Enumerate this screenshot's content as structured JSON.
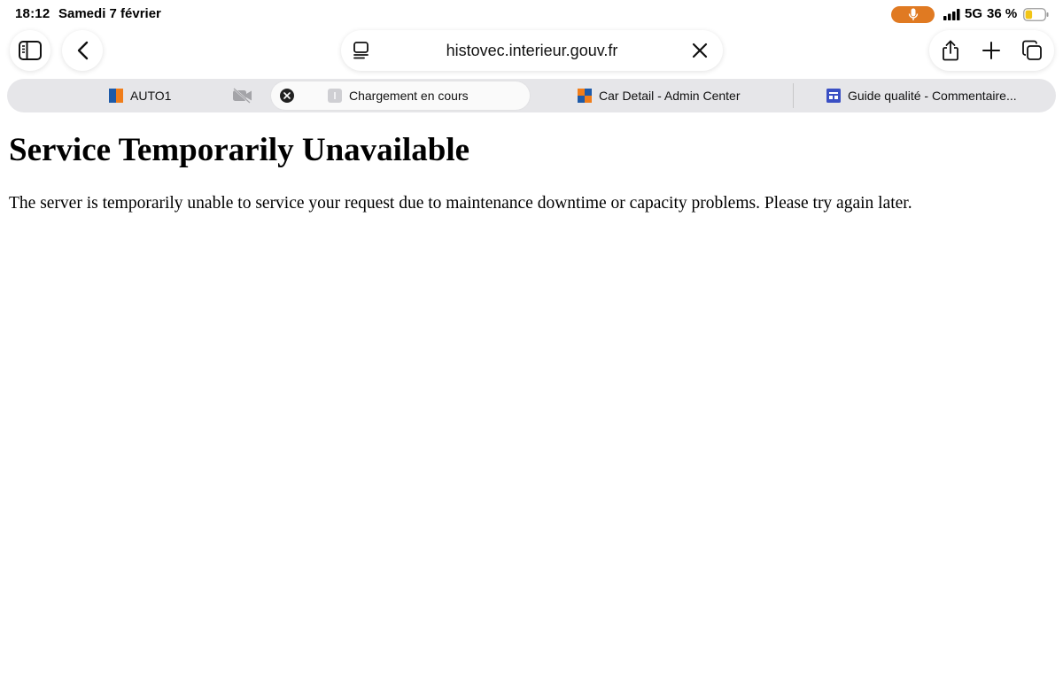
{
  "status_bar": {
    "time": "18:12",
    "date": "Samedi 7 février",
    "network": "5G",
    "battery_percent": "36 %",
    "battery_level": 0.36,
    "mic_color": "#e07a22"
  },
  "toolbar": {
    "url": "histovec.interieur.gouv.fr",
    "icons": [
      "sidebar-icon",
      "back-icon",
      "reader-icon",
      "stop-loading-icon",
      "share-icon",
      "new-tab-icon",
      "tabs-overview-icon"
    ]
  },
  "tabs": [
    {
      "label": "AUTO1",
      "icon": "auto1-favicon"
    },
    {
      "label": "Chargement en cours",
      "icon": "loading-favicon",
      "active": true
    },
    {
      "label": "Car Detail - Admin Center",
      "icon": "admin-favicon"
    },
    {
      "label": "Guide qualité - Commentaire...",
      "icon": "guide-favicon"
    }
  ],
  "page": {
    "title": "Service Temporarily Unavailable",
    "message": "The server is temporarily unable to service your request due to maintenance downtime or capacity problems. Please try again later."
  }
}
